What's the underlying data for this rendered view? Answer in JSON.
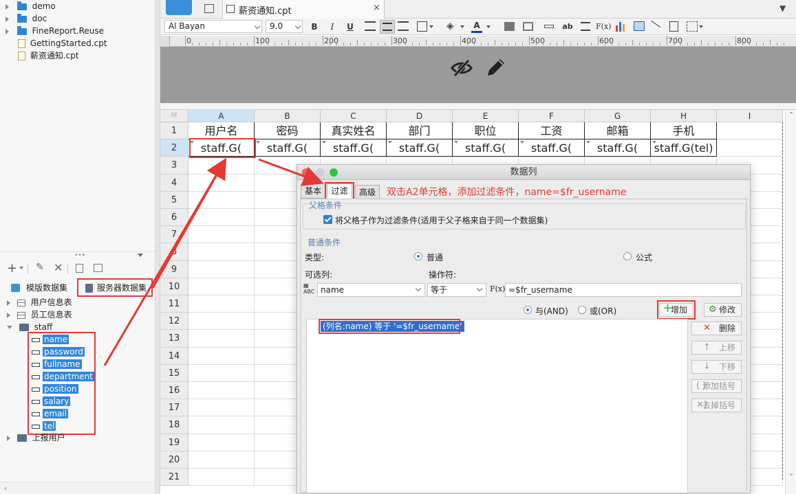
{
  "tree_top": [
    {
      "label": "demo",
      "type": "folder",
      "expandable": true
    },
    {
      "label": "doc",
      "type": "folder",
      "expandable": true
    },
    {
      "label": "FineReport.Reuse",
      "type": "folder",
      "expandable": true
    },
    {
      "label": "GettingStarted.cpt",
      "type": "file",
      "expandable": false
    },
    {
      "label": "薪资通知.cpt",
      "type": "file",
      "expandable": false
    }
  ],
  "ds_tabs": {
    "template": "模版数据集",
    "server": "服务器数据集"
  },
  "ds_tree": {
    "items": [
      "用户信息表",
      "员工信息表"
    ],
    "staff": "staff",
    "staff_fields": [
      "name",
      "password",
      "fullname",
      "department",
      "position",
      "salary",
      "email",
      "tel"
    ],
    "report_users": "上报用户"
  },
  "doc_tab": "薪资通知.cpt",
  "toolbar": {
    "font": "Al Bayan",
    "size": "9.0",
    "bold": "B",
    "italic": "I",
    "underline": "U",
    "font_color": "A",
    "fx": "F(x)",
    "ab": "ab"
  },
  "ruler_marks": [
    "0",
    "100",
    "200",
    "300",
    "400",
    "500",
    "600",
    "700",
    "800"
  ],
  "columns": [
    "A",
    "B",
    "C",
    "D",
    "E",
    "F",
    "G",
    "H",
    "I"
  ],
  "rows": [
    "1",
    "2",
    "3",
    "4",
    "5",
    "6",
    "7",
    "8",
    "9",
    "10",
    "11",
    "12",
    "13",
    "14",
    "15",
    "16",
    "17",
    "18",
    "19",
    "20",
    "21"
  ],
  "row1": [
    "用户名",
    "密码",
    "真实姓名",
    "部门",
    "职位",
    "工资",
    "邮箱",
    "手机"
  ],
  "row2": [
    "staff.G(",
    "staff.G(",
    "staff.G(",
    "staff.G(",
    "staff.G(",
    "staff.G(",
    "staff.G(",
    "staff.G(tel)"
  ],
  "dialog": {
    "title": "数据列",
    "tabs": [
      "基本",
      "过滤",
      "高级"
    ],
    "annotation": "双击A2单元格，添加过滤条件，name=$fr_username",
    "parent_group": "父格条件",
    "parent_check": "将父格子作为过滤条件(适用于父子格来自于同一个数据集)",
    "normal_group": "普通条件",
    "type_label": "类型:",
    "type_normal": "普通",
    "type_formula": "公式",
    "optional_col_label": "可选列:",
    "operator_label": "操作符:",
    "col_value": "name",
    "op_value": "等于",
    "fx_label": "F(x)",
    "expr_value": "=$fr_username",
    "and_label": "与(AND)",
    "or_label": "或(OR)",
    "add": "增加",
    "modify": "修改",
    "delete": "删除",
    "move_up": "上移",
    "move_down": "下移",
    "add_bracket": "添加括号",
    "remove_bracket": "去掉括号",
    "condition": "(列名:name) 等于 '=$fr_username'"
  },
  "colors": {
    "accent": "#2f86e0",
    "annotation": "#e53935",
    "add_icon": "#3cae3c"
  }
}
